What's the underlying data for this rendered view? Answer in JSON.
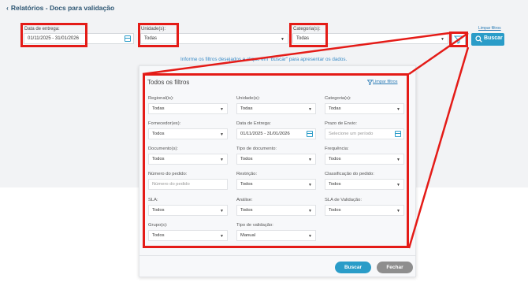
{
  "page": {
    "title": "Relatórios - Docs para validação"
  },
  "top_filters": {
    "data_entrega": {
      "label": "Data de entrega:",
      "value": "01/11/2025 - 31/01/2026"
    },
    "unidade": {
      "label": "Unidade(s):",
      "value": "Todas"
    },
    "categoria": {
      "label": "Categoria(s):",
      "value": "Todas"
    },
    "limpar_label": "Limpar filtros",
    "buscar_label": "Buscar"
  },
  "info_message": "Informe os filtros desejados e clique em \"buscar\" para apresentar os dados.",
  "panel": {
    "title": "Todos os filtros",
    "limpar_label": "Limpar filtros",
    "fields": {
      "regional": {
        "label": "Regional(is):",
        "value": "Todas"
      },
      "unidade": {
        "label": "Unidade(s):",
        "value": "Todas"
      },
      "categoria": {
        "label": "Categoria(s):",
        "value": "Todas"
      },
      "fornecedor": {
        "label": "Fornecedor(es):",
        "value": "Todos"
      },
      "data_entrega": {
        "label": "Data de Entrega:",
        "value": "01/11/2025 - 31/01/2026"
      },
      "prazo_envio": {
        "label": "Prazo de Envio:",
        "placeholder": "Selecione um período"
      },
      "documento": {
        "label": "Documento(s):",
        "value": "Todos"
      },
      "tipo_documento": {
        "label": "Tipo de documento:",
        "value": "Todos"
      },
      "frequencia": {
        "label": "Frequência:",
        "value": "Todos"
      },
      "numero_pedido": {
        "label": "Número do pedido:",
        "placeholder": "Número do pedido"
      },
      "restricao": {
        "label": "Restrição:",
        "value": "Todos"
      },
      "classificacao": {
        "label": "Classificação do pedido:",
        "value": "Todos"
      },
      "sla": {
        "label": "SLA:",
        "value": "Todos"
      },
      "analise": {
        "label": "Análise:",
        "value": "Todos"
      },
      "sla_validacao": {
        "label": "SLA de Validação:",
        "value": "Todos"
      },
      "grupo": {
        "label": "Grupo(s):",
        "value": "Todos"
      },
      "tipo_validacao": {
        "label": "Tipo de validação:",
        "value": "Manual"
      }
    },
    "buscar_label": "Buscar",
    "fechar_label": "Fechar"
  },
  "colors": {
    "accent": "#2a9cc8",
    "highlight": "#e41b17",
    "title": "#2d5673"
  }
}
